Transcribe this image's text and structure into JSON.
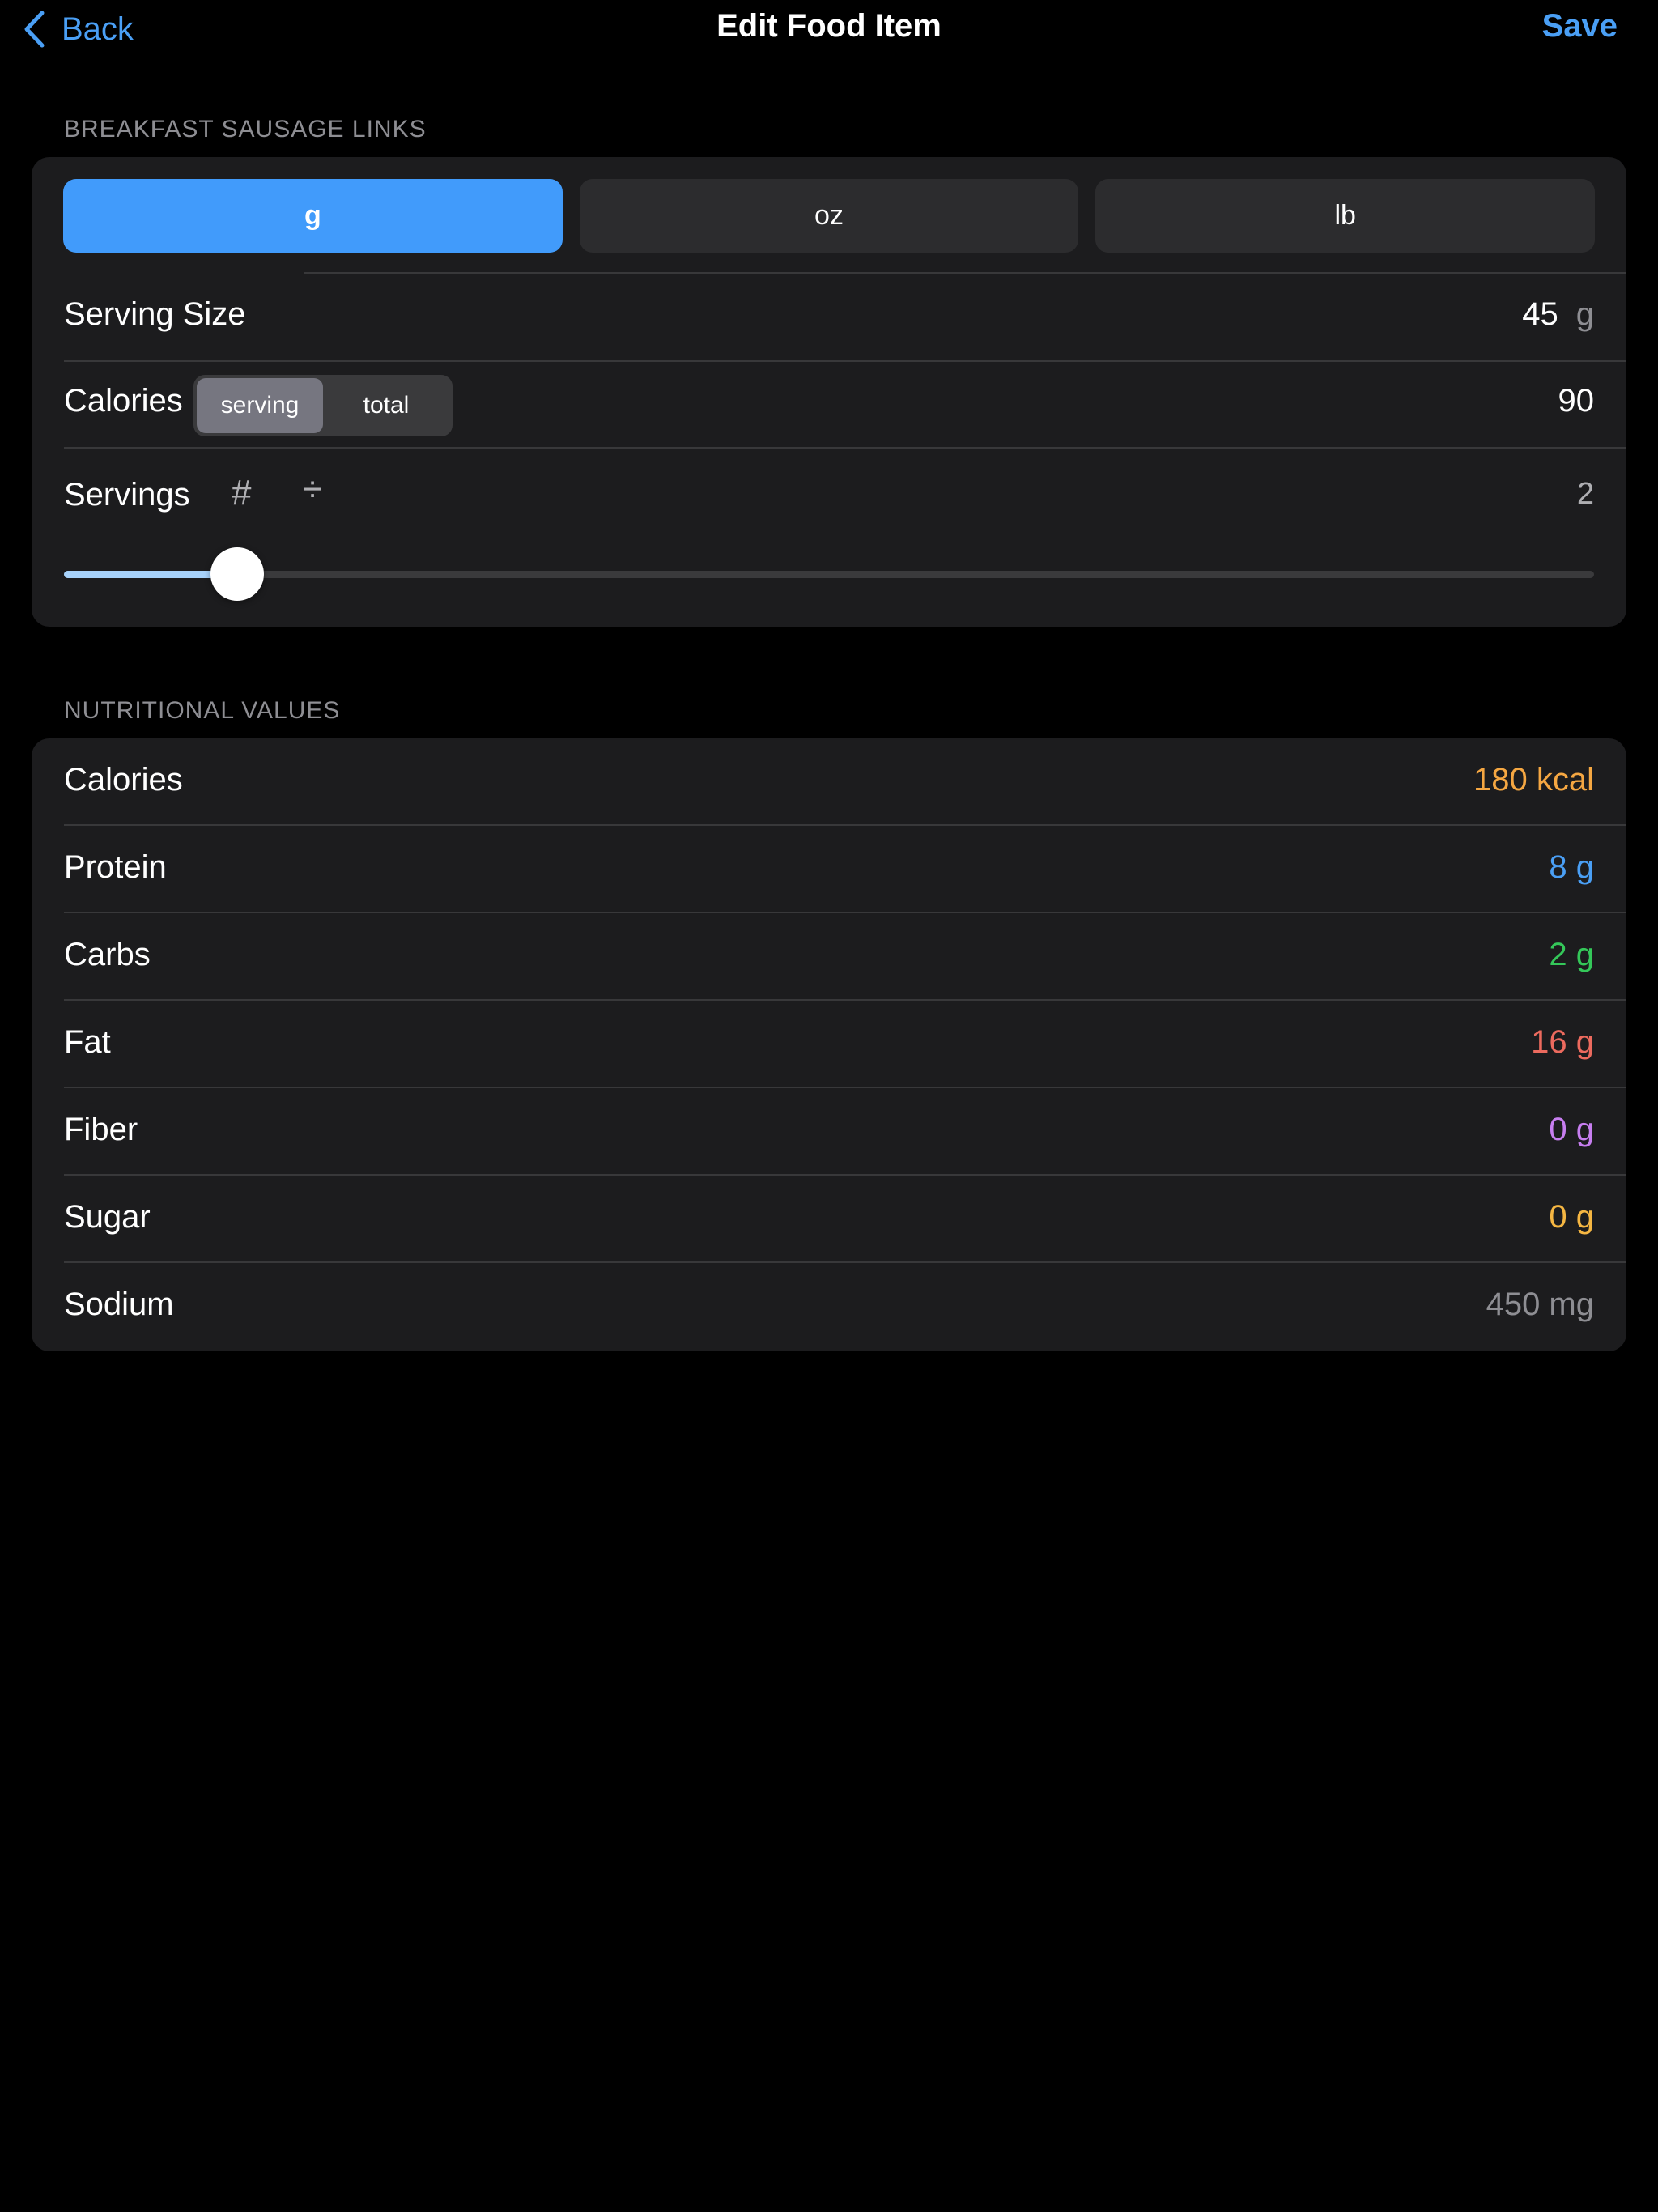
{
  "nav": {
    "back_label": "Back",
    "title": "Edit Food Item",
    "save_label": "Save"
  },
  "food": {
    "section_title": "BREAKFAST SAUSAGE LINKS",
    "units": [
      {
        "label": "g",
        "selected": true
      },
      {
        "label": "oz",
        "selected": false
      },
      {
        "label": "lb",
        "selected": false
      }
    ],
    "serving_size": {
      "label": "Serving Size",
      "value": "45",
      "unit": "g"
    },
    "calories": {
      "label": "Calories",
      "mode_options": [
        {
          "label": "serving",
          "selected": true
        },
        {
          "label": "total",
          "selected": false
        }
      ],
      "value": "90"
    },
    "servings": {
      "label": "Servings",
      "count_icon": "hash-icon",
      "divide_icon": "divide-icon",
      "value": "2",
      "slider_fraction": 0.113
    }
  },
  "nutrition": {
    "section_title": "NUTRITIONAL VALUES",
    "rows": [
      {
        "label": "Calories",
        "value": "180 kcal",
        "color": "#f5a742"
      },
      {
        "label": "Protein",
        "value": "8 g",
        "color": "#4a9ff5"
      },
      {
        "label": "Carbs",
        "value": "2 g",
        "color": "#34c759"
      },
      {
        "label": "Fat",
        "value": "16 g",
        "color": "#ec6a5e"
      },
      {
        "label": "Fiber",
        "value": "0 g",
        "color": "#c77ef0"
      },
      {
        "label": "Sugar",
        "value": "0 g",
        "color": "#f5b642"
      },
      {
        "label": "Sodium",
        "value": "450 mg",
        "color": "#8e8e93"
      }
    ]
  },
  "colors": {
    "accent": "#419bfb",
    "link": "#4a9ff5",
    "background": "#000000",
    "card": "#1c1c1e"
  }
}
